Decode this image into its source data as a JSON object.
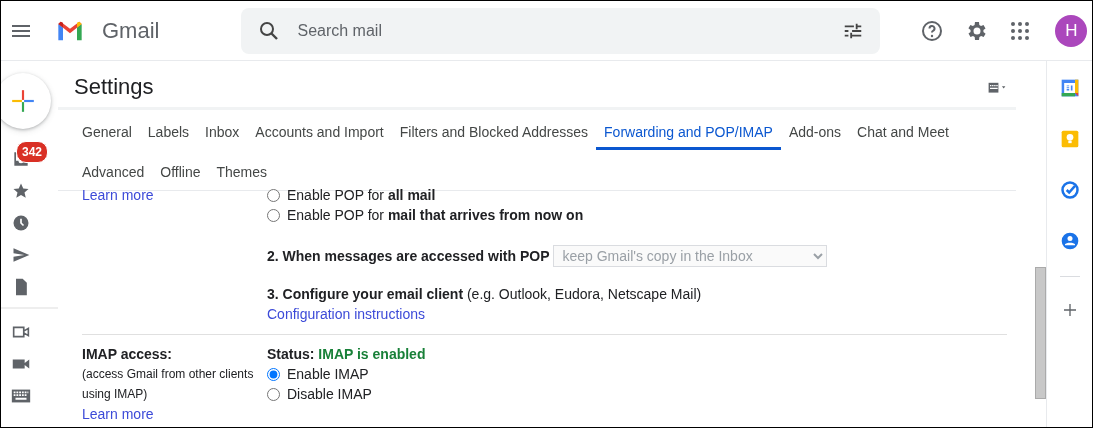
{
  "header": {
    "app_name": "Gmail",
    "search": {
      "placeholder": "Search mail"
    },
    "avatar": "H"
  },
  "left_rail": {
    "inbox_badge": "342"
  },
  "settings": {
    "title": "Settings",
    "tabs": [
      {
        "label": "General",
        "selected": false
      },
      {
        "label": "Labels",
        "selected": false
      },
      {
        "label": "Inbox",
        "selected": false
      },
      {
        "label": "Accounts and Import",
        "selected": false
      },
      {
        "label": "Filters and Blocked Addresses",
        "selected": false
      },
      {
        "label": "Forwarding and POP/IMAP",
        "selected": true
      },
      {
        "label": "Add-ons",
        "selected": false
      },
      {
        "label": "Chat and Meet",
        "selected": false
      },
      {
        "label": "Advanced",
        "selected": false
      },
      {
        "label": "Offline",
        "selected": false
      },
      {
        "label": "Themes",
        "selected": false
      }
    ],
    "pop": {
      "learn_more": "Learn more",
      "options": [
        {
          "text": "Enable POP for **all mail**",
          "selected": false
        },
        {
          "text": "Enable POP for **mail that arrives from now on**",
          "selected": false
        }
      ],
      "when_accessed": {
        "label": "2. When messages are accessed with POP",
        "value": "keep Gmail's copy in the Inbox",
        "disabled": true
      },
      "configure": {
        "text": "**3. Configure your email client** (e.g. Outlook, Eudora, Netscape Mail)",
        "link": "Configuration instructions"
      }
    },
    "imap": {
      "label": "IMAP access:",
      "description": "(access Gmail from other clients using IMAP)",
      "learn_more": "Learn more",
      "status_label": "Status:",
      "status_value": "IMAP is enabled",
      "options": [
        {
          "text": "Enable IMAP",
          "selected": true
        },
        {
          "text": "Disable IMAP",
          "selected": false
        }
      ]
    }
  }
}
